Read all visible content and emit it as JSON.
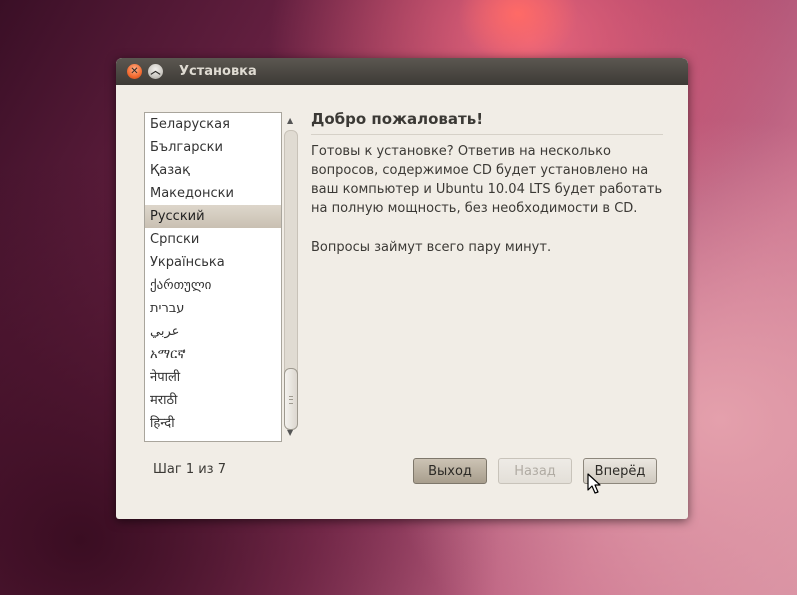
{
  "window": {
    "title": "Установка"
  },
  "language_list": {
    "items": [
      "Беларуская",
      "Български",
      "Қазақ",
      "Македонски",
      "Русский",
      "Српски",
      "Українська",
      "ქართული",
      "עברית",
      "عربي",
      "አማርኛ",
      "नेपाली",
      "मराठी",
      "हिन्दी"
    ],
    "selected": "Русский"
  },
  "content": {
    "heading": "Добро пожаловать!",
    "paragraph1": "Готовы к установке? Ответив на несколько вопросов, содержимое CD будет установлено на ваш компьютер и Ubuntu 10.04 LTS будет работать на полную мощность, без необходимости в CD.",
    "paragraph2": "Вопросы займут всего пару минут."
  },
  "footer": {
    "step": "Шаг 1 из 7",
    "quit_label": "Выход",
    "back_label": "Назад",
    "next_label": "Вперёд"
  },
  "icons": {
    "close": "close-icon",
    "minimize": "minimize-icon",
    "scroll_up": "arrow-up-icon",
    "scroll_down": "arrow-down-icon",
    "cursor": "mouse-pointer-icon"
  },
  "colors": {
    "titlebar": "#3d3a36",
    "window_bg": "#f1ede6",
    "close_button": "#f26a2f",
    "selection": "#c9c0b2"
  }
}
